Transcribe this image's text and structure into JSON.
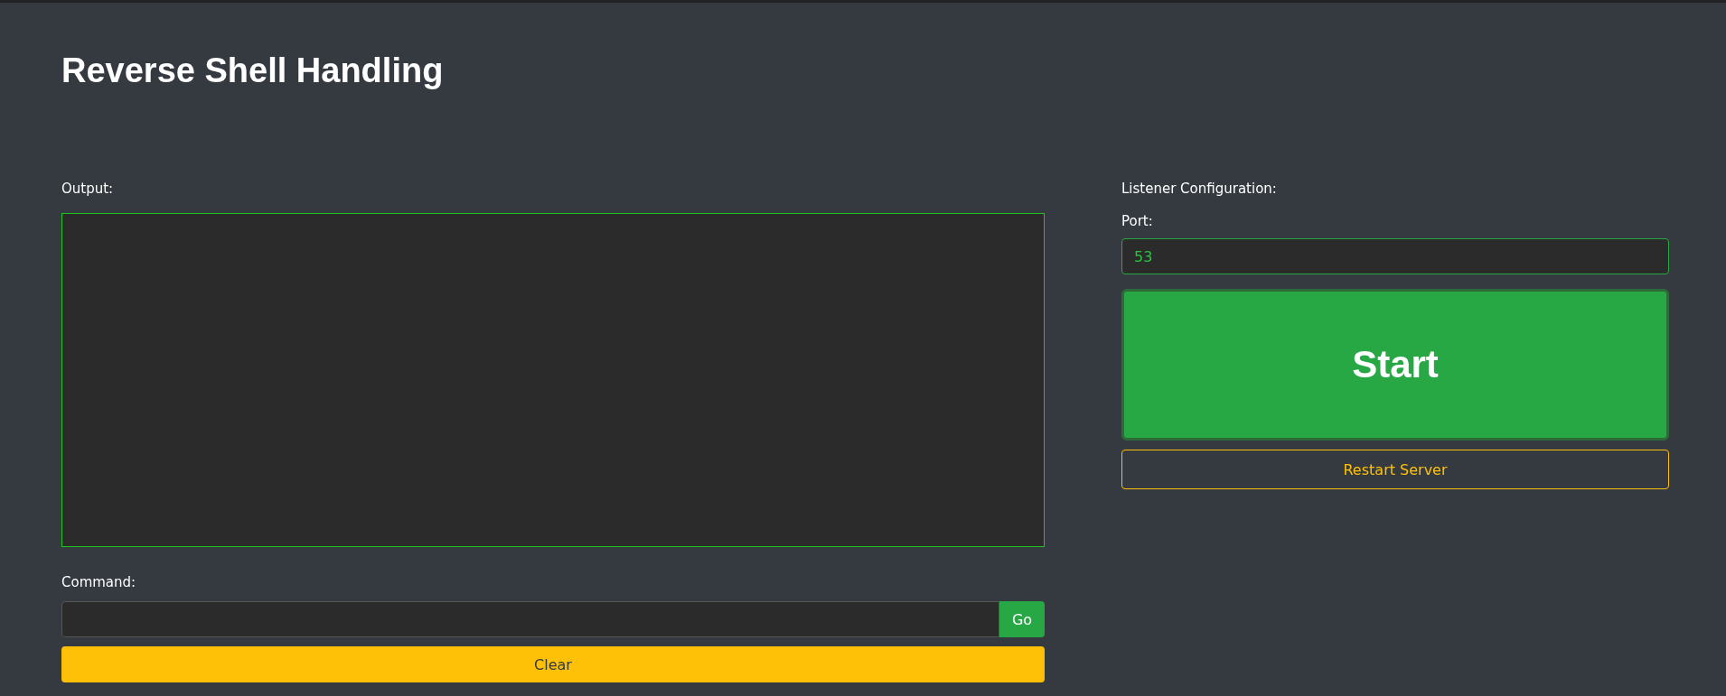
{
  "title": "Reverse Shell Handling",
  "output": {
    "label": "Output:"
  },
  "command": {
    "label": "Command:",
    "go": "Go",
    "clear": "Clear"
  },
  "listener": {
    "label": "Listener Configuration:",
    "port_label": "Port:",
    "port_value": "53",
    "start": "Start",
    "restart": "Restart Server"
  }
}
